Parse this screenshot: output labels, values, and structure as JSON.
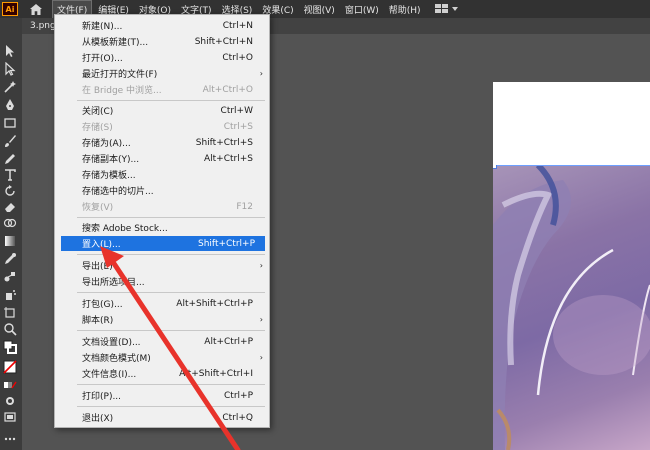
{
  "menubar": {
    "logo": "Ai",
    "items": [
      "文件(F)",
      "编辑(E)",
      "对象(O)",
      "文字(T)",
      "选择(S)",
      "效果(C)",
      "视图(V)",
      "窗口(W)",
      "帮助(H)"
    ]
  },
  "document": {
    "tab_label": "3.png"
  },
  "file_menu": {
    "new": {
      "label": "新建(N)...",
      "shortcut": "Ctrl+N"
    },
    "new_from_template": {
      "label": "从模板新建(T)...",
      "shortcut": "Shift+Ctrl+N"
    },
    "open": {
      "label": "打开(O)...",
      "shortcut": "Ctrl+O"
    },
    "open_recent": {
      "label": "最近打开的文件(F)"
    },
    "browse_bridge": {
      "label": "在 Bridge 中浏览...",
      "shortcut": "Alt+Ctrl+O"
    },
    "close": {
      "label": "关闭(C)",
      "shortcut": "Ctrl+W"
    },
    "save": {
      "label": "存储(S)",
      "shortcut": "Ctrl+S"
    },
    "save_as": {
      "label": "存储为(A)...",
      "shortcut": "Shift+Ctrl+S"
    },
    "save_copy": {
      "label": "存储副本(Y)...",
      "shortcut": "Alt+Ctrl+S"
    },
    "save_as_template": {
      "label": "存储为模板..."
    },
    "save_selected_slices": {
      "label": "存储选中的切片..."
    },
    "revert": {
      "label": "恢复(V)",
      "shortcut": "F12"
    },
    "search_stock": {
      "label": "搜索 Adobe Stock..."
    },
    "place": {
      "label": "置入(L)...",
      "shortcut": "Shift+Ctrl+P"
    },
    "export": {
      "label": "导出(E)"
    },
    "export_selection": {
      "label": "导出所选项目..."
    },
    "package": {
      "label": "打包(G)...",
      "shortcut": "Alt+Shift+Ctrl+P"
    },
    "scripts": {
      "label": "脚本(R)"
    },
    "document_setup": {
      "label": "文档设置(D)...",
      "shortcut": "Alt+Ctrl+P"
    },
    "document_color_mode": {
      "label": "文档颜色模式(M)"
    },
    "file_info": {
      "label": "文件信息(I)...",
      "shortcut": "Alt+Shift+Ctrl+I"
    },
    "print": {
      "label": "打印(P)...",
      "shortcut": "Ctrl+P"
    },
    "exit": {
      "label": "退出(X)",
      "shortcut": "Ctrl+Q"
    }
  },
  "colors": {
    "menubar_bg": "#323232",
    "workspace_bg": "#535353",
    "menu_bg": "#f0f0f0",
    "highlight": "#1e73e0",
    "annotation_arrow": "#e8332b"
  }
}
